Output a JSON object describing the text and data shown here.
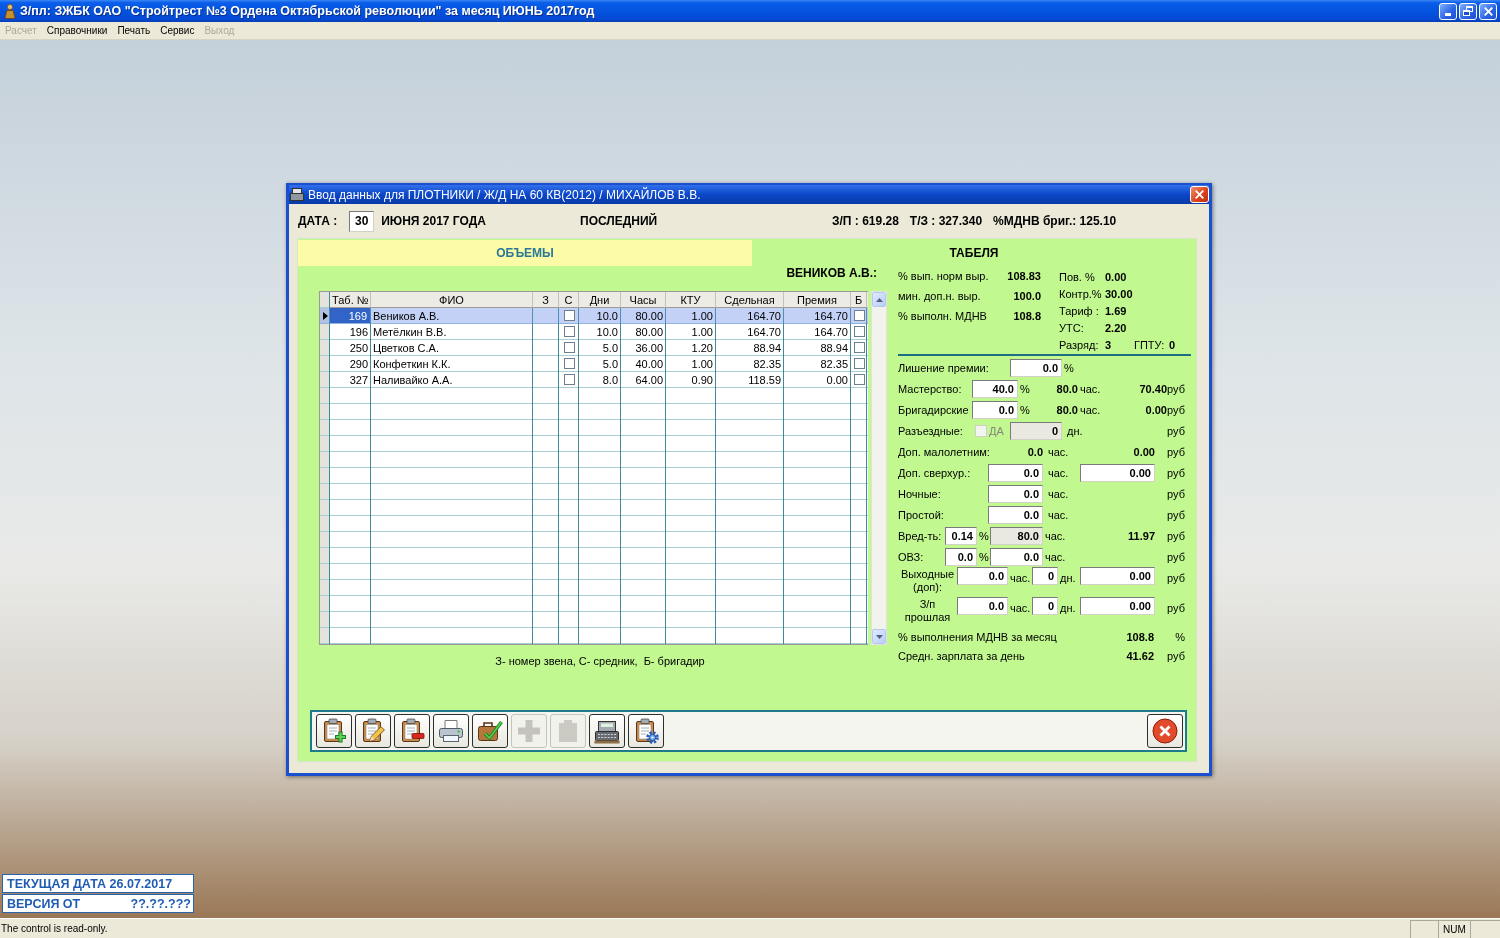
{
  "window": {
    "title": "З/пл: ЗЖБК ОАО \"Стройтрест №3 Ордена Октябрьской революции\" за месяц ИЮНЬ 2017год"
  },
  "menu": [
    {
      "label": "Расчет",
      "disabled": true
    },
    {
      "label": "Справочники",
      "disabled": false
    },
    {
      "label": "Печать",
      "disabled": false
    },
    {
      "label": "Сервис",
      "disabled": false
    },
    {
      "label": "Выход",
      "disabled": true
    }
  ],
  "dialog": {
    "title": "Ввод данных для ПЛОТНИКИ / Ж/Д НА 60 КВ(2012) / МИХАЙЛОВ В.В.",
    "header": {
      "date_label": "ДАТА :",
      "day": "30",
      "month": "ИЮНЯ 2017 ГОДА",
      "mode": "ПОСЛЕДНИЙ",
      "totals": [
        "З/П : 619.28",
        "Т/З : 327.340",
        "%МДНВ бриг.: 125.10"
      ]
    },
    "tabs": [
      {
        "label": "ОБЪЕМЫ",
        "selected": false
      },
      {
        "label": "ТАБЕЛЯ",
        "selected": true
      }
    ],
    "worker": "ВЕНИКОВ А.В.:",
    "table": {
      "columns": [
        "Таб. №",
        "ФИО",
        "З",
        "С",
        "Дни",
        "Часы",
        "КТУ",
        "Сдельная",
        "Премия",
        "Б"
      ],
      "rows": [
        {
          "selected": true,
          "tab_no": "169",
          "name": "Веников А.В.",
          "srednik": false,
          "days": "10.0",
          "hours": "80.00",
          "ktu": "1.00",
          "piecework": "164.70",
          "bonus": "164.70",
          "brigadir": false
        },
        {
          "selected": false,
          "tab_no": "196",
          "name": "Метёлкин В.В.",
          "srednik": false,
          "days": "10.0",
          "hours": "80.00",
          "ktu": "1.00",
          "piecework": "164.70",
          "bonus": "164.70",
          "brigadir": false
        },
        {
          "selected": false,
          "tab_no": "250",
          "name": "Цветков С.А.",
          "srednik": false,
          "days": "5.0",
          "hours": "36.00",
          "ktu": "1.20",
          "piecework": "88.94",
          "bonus": "88.94",
          "brigadir": false
        },
        {
          "selected": false,
          "tab_no": "290",
          "name": "Конфеткин К.К.",
          "srednik": false,
          "days": "5.0",
          "hours": "40.00",
          "ktu": "1.00",
          "piecework": "82.35",
          "bonus": "82.35",
          "brigadir": false
        },
        {
          "selected": false,
          "tab_no": "327",
          "name": "Наливайко А.А.",
          "srednik": false,
          "days": "8.0",
          "hours": "64.00",
          "ktu": "0.90",
          "piecework": "118.59",
          "bonus": "0.00",
          "brigadir": false
        }
      ]
    },
    "legend": "З- номер звена, С- средник,  Б- бригадир",
    "stats": {
      "left": [
        {
          "label": "% вып. норм выр.",
          "value": "108.83"
        },
        {
          "label": "мин. доп.н. выр.",
          "value": "100.0"
        },
        {
          "label": "% выполн. МДНВ",
          "value": "108.8"
        }
      ],
      "right": [
        {
          "label": "Пов. %",
          "value": "0.00"
        },
        {
          "label": "Контр.%",
          "value": "30.00"
        },
        {
          "label": "Тариф :",
          "value": "1.69"
        },
        {
          "label": "УТС:",
          "value": "2.20"
        }
      ],
      "grade": [
        {
          "label": "Разряд:",
          "value": "3"
        },
        {
          "label": "ГПТУ:",
          "value": "0"
        }
      ]
    },
    "entries": [
      {
        "kind": "penalty",
        "items": [
          {
            "kind": "label",
            "text": "Лишение премии:"
          },
          {
            "kind": "field",
            "value": "0.0",
            "disabled": false
          },
          {
            "kind": "unit",
            "text": "%"
          }
        ]
      },
      {
        "kind": "rate",
        "items": [
          {
            "kind": "label",
            "text": "Мастерство:"
          },
          {
            "kind": "field",
            "value": "40.0",
            "disabled": false
          },
          {
            "kind": "unit",
            "text": "%"
          },
          {
            "kind": "number",
            "text": "80.0"
          },
          {
            "kind": "unit",
            "text": "час."
          },
          {
            "kind": "number",
            "text": "70.40"
          },
          {
            "kind": "unit",
            "text": "руб"
          }
        ]
      },
      {
        "kind": "rate",
        "items": [
          {
            "kind": "label",
            "text": "Бригадирские"
          },
          {
            "kind": "field",
            "value": "0.0",
            "disabled": false
          },
          {
            "kind": "unit",
            "text": "%"
          },
          {
            "kind": "number",
            "text": "80.0"
          },
          {
            "kind": "unit",
            "text": "час."
          },
          {
            "kind": "number",
            "text": "0.00"
          },
          {
            "kind": "unit",
            "text": "руб"
          }
        ]
      },
      {
        "kind": "trip",
        "items": [
          {
            "kind": "label",
            "text": "Разъездные:"
          },
          {
            "kind": "checkbox",
            "label": "ДА",
            "checked": false,
            "disabled": true
          },
          {
            "kind": "field",
            "value": "0",
            "disabled": true
          },
          {
            "kind": "unit",
            "text": "дн."
          },
          {
            "kind": "unit",
            "text": "руб"
          }
        ]
      },
      {
        "kind": "hours",
        "items": [
          {
            "kind": "label",
            "text": "Доп. малолетним:"
          },
          {
            "kind": "number",
            "text": "0.0"
          },
          {
            "kind": "unit",
            "text": "час."
          },
          {
            "kind": "number",
            "text": "0.00"
          },
          {
            "kind": "unit",
            "text": "руб"
          }
        ]
      },
      {
        "kind": "hours",
        "items": [
          {
            "kind": "label",
            "text": "Доп. сверхур.:"
          },
          {
            "kind": "field",
            "value": "0.0",
            "disabled": false
          },
          {
            "kind": "unit",
            "text": "час."
          },
          {
            "kind": "field",
            "value": "0.00",
            "disabled": false
          },
          {
            "kind": "unit",
            "text": "руб"
          }
        ]
      },
      {
        "kind": "hours",
        "items": [
          {
            "kind": "label",
            "text": "Ночные:"
          },
          {
            "kind": "field",
            "value": "0.0",
            "disabled": false
          },
          {
            "kind": "unit",
            "text": "час."
          },
          {
            "kind": "unit",
            "text": "руб"
          }
        ]
      },
      {
        "kind": "hours",
        "items": [
          {
            "kind": "label",
            "text": "Простой:"
          },
          {
            "kind": "field",
            "value": "0.0",
            "disabled": false
          },
          {
            "kind": "unit",
            "text": "час."
          },
          {
            "kind": "unit",
            "text": "руб"
          }
        ]
      },
      {
        "kind": "harm",
        "items": [
          {
            "kind": "label",
            "text": "Вред-ть:"
          },
          {
            "kind": "field",
            "value": "0.14",
            "disabled": false
          },
          {
            "kind": "unit",
            "text": "%"
          },
          {
            "kind": "field",
            "value": "80.0",
            "disabled": true
          },
          {
            "kind": "unit",
            "text": "час."
          },
          {
            "kind": "number",
            "text": "11.97"
          },
          {
            "kind": "unit",
            "text": "руб"
          }
        ]
      },
      {
        "kind": "harm",
        "items": [
          {
            "kind": "label",
            "text": "ОВЗ:"
          },
          {
            "kind": "field",
            "value": "0.0",
            "disabled": false
          },
          {
            "kind": "unit",
            "text": "%"
          },
          {
            "kind": "field",
            "value": "0.0",
            "disabled": false
          },
          {
            "kind": "unit",
            "text": "час."
          },
          {
            "kind": "unit",
            "text": "руб"
          }
        ]
      },
      {
        "kind": "extra",
        "items": [
          {
            "kind": "label",
            "text": "Выходные (доп):"
          },
          {
            "kind": "field",
            "value": "0.0",
            "disabled": false
          },
          {
            "kind": "unit",
            "text": "час."
          },
          {
            "kind": "field",
            "value": "0",
            "disabled": false
          },
          {
            "kind": "unit",
            "text": "дн."
          },
          {
            "kind": "field",
            "value": "0.00",
            "disabled": false
          },
          {
            "kind": "unit",
            "text": "руб"
          }
        ]
      },
      {
        "kind": "extra",
        "items": [
          {
            "kind": "label",
            "text": "З/п прошлая"
          },
          {
            "kind": "field",
            "value": "0.0",
            "disabled": false
          },
          {
            "kind": "unit",
            "text": "час."
          },
          {
            "kind": "field",
            "value": "0",
            "disabled": false
          },
          {
            "kind": "unit",
            "text": "дн."
          },
          {
            "kind": "field",
            "value": "0.00",
            "disabled": false
          },
          {
            "kind": "unit",
            "text": "руб"
          }
        ]
      },
      {
        "kind": "total",
        "items": [
          {
            "kind": "label",
            "text": "% выполнения МДНВ за месяц"
          },
          {
            "kind": "number",
            "text": "108.8"
          },
          {
            "kind": "unit",
            "text": "%"
          }
        ]
      },
      {
        "kind": "total",
        "items": [
          {
            "kind": "label",
            "text": "Средн. зарплата за день"
          },
          {
            "kind": "number",
            "text": "41.62"
          },
          {
            "kind": "unit",
            "text": "руб"
          }
        ]
      }
    ],
    "toolbar": [
      {
        "kind": "add",
        "disabled": false
      },
      {
        "kind": "edit",
        "disabled": false
      },
      {
        "kind": "delete",
        "disabled": false
      },
      {
        "kind": "print",
        "disabled": false
      },
      {
        "kind": "approve",
        "disabled": false
      },
      {
        "kind": "insert",
        "disabled": true
      },
      {
        "kind": "paste",
        "disabled": true
      },
      {
        "kind": "register",
        "disabled": false
      },
      {
        "kind": "settings",
        "disabled": false
      },
      {
        "kind": "close",
        "disabled": false
      }
    ]
  },
  "info": {
    "current_date": "ТЕКУЩАЯ ДАТА 26.07.2017",
    "version_label": "ВЕРСИЯ ОТ",
    "version": "??.??.???"
  },
  "status_bar": {
    "message": "The control is read-only.",
    "indicator": "NUM"
  }
}
